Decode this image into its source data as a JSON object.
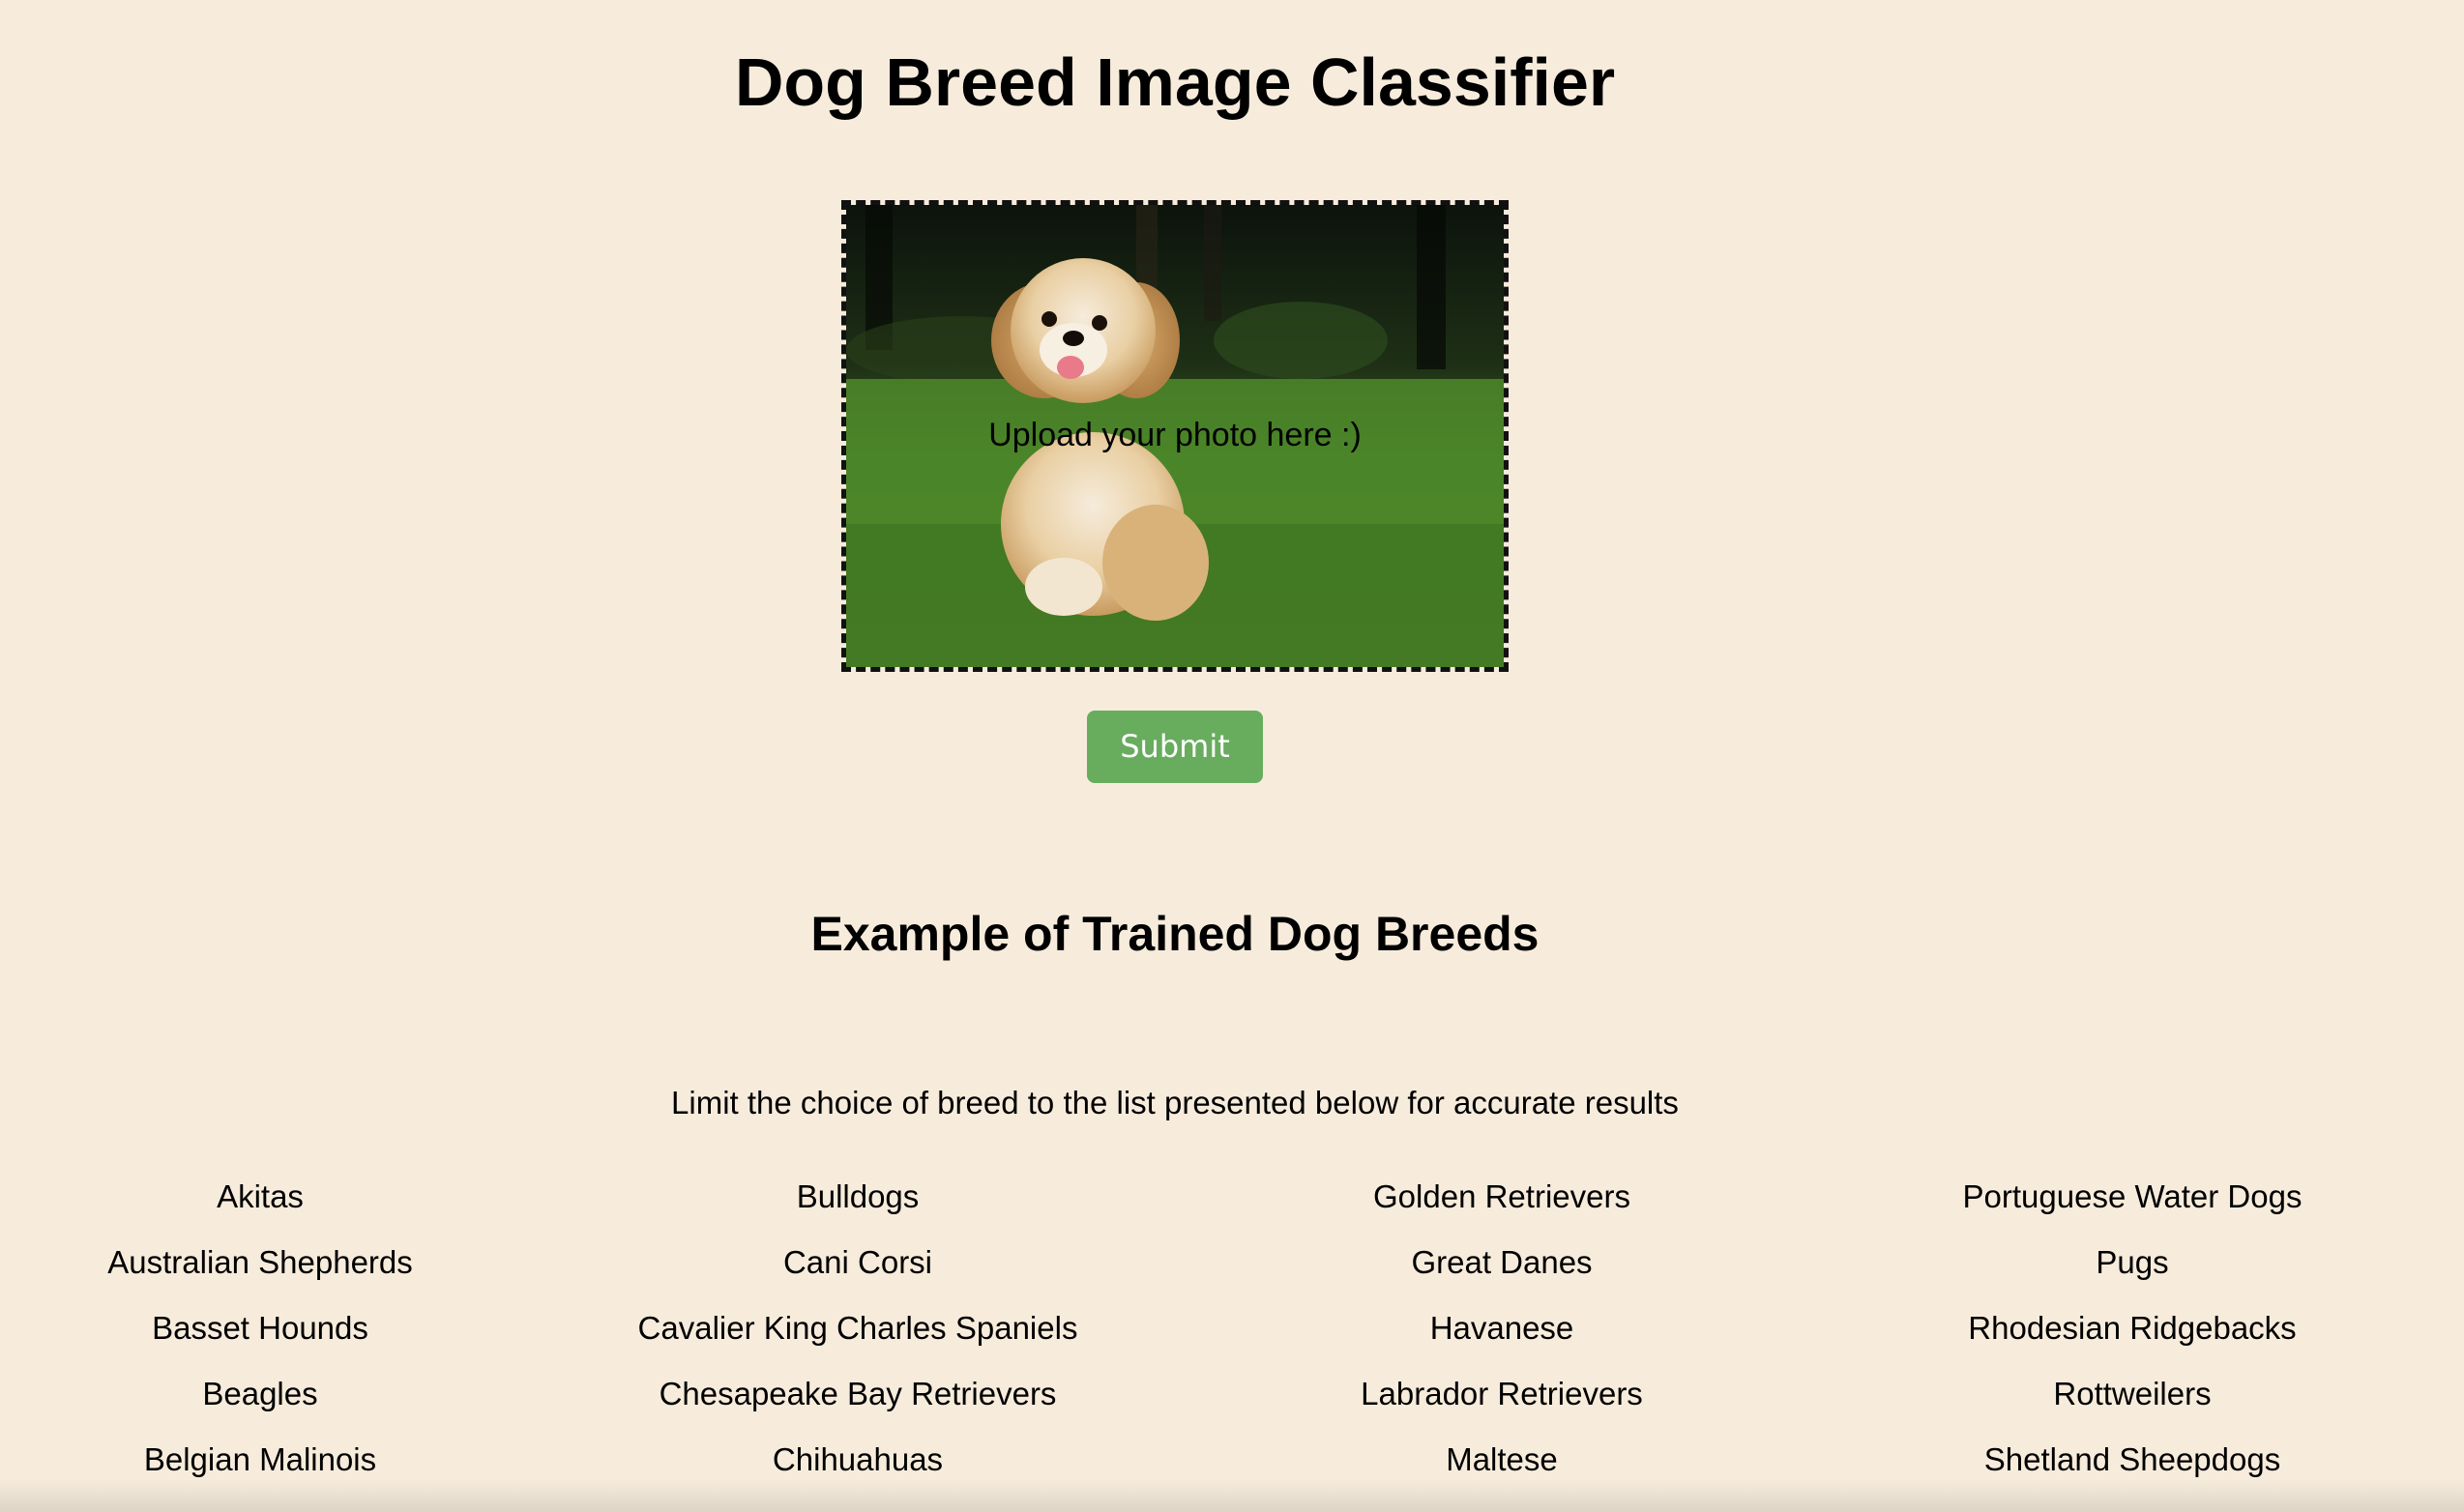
{
  "page": {
    "title": "Dog Breed Image Classifier",
    "background_color": "#f7ecdc"
  },
  "upload": {
    "label": "Upload your photo here :)",
    "image_description": "dog-photo-on-grass"
  },
  "submit": {
    "label": "Submit",
    "color": "#68ad5e"
  },
  "breeds_section": {
    "title": "Example of Trained Dog Breeds",
    "instruction": "Limit the choice of breed to the list presented below for accurate results",
    "columns": [
      [
        "Akitas",
        "Australian Shepherds",
        "Basset Hounds",
        "Beagles",
        "Belgian Malinois"
      ],
      [
        "Bulldogs",
        "Cani Corsi",
        "Cavalier King Charles Spaniels",
        "Chesapeake Bay Retrievers",
        "Chihuahuas"
      ],
      [
        "Golden Retrievers",
        "Great Danes",
        "Havanese",
        "Labrador Retrievers",
        "Maltese"
      ],
      [
        "Portuguese Water Dogs",
        "Pugs",
        "Rhodesian Ridgebacks",
        "Rottweilers",
        "Shetland Sheepdogs"
      ]
    ]
  }
}
